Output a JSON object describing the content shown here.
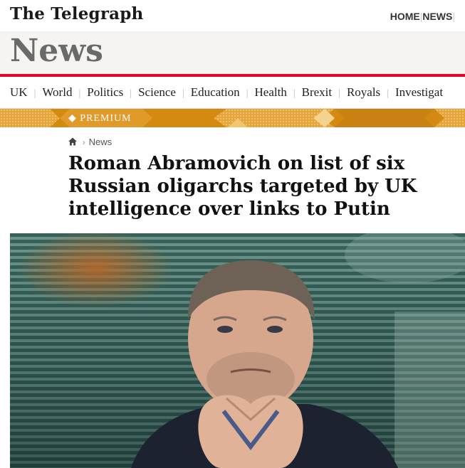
{
  "header": {
    "logo": "The Telegraph",
    "nav": [
      "HOME",
      "NEWS"
    ]
  },
  "section_title": "News",
  "subnav": [
    "UK",
    "World",
    "Politics",
    "Science",
    "Education",
    "Health",
    "Brexit",
    "Royals",
    "Investigat"
  ],
  "premium_label": "PREMIUM",
  "breadcrumb": {
    "icon": "home-icon",
    "label": "News"
  },
  "headline": "Roman Abramovich on list of six Russian oligarchs targeted by UK intelligence over links to Putin",
  "colors": {
    "accent_red": "#e4002b",
    "premium_gold": "#d48a10",
    "section_bg": "#f6f4f0"
  }
}
